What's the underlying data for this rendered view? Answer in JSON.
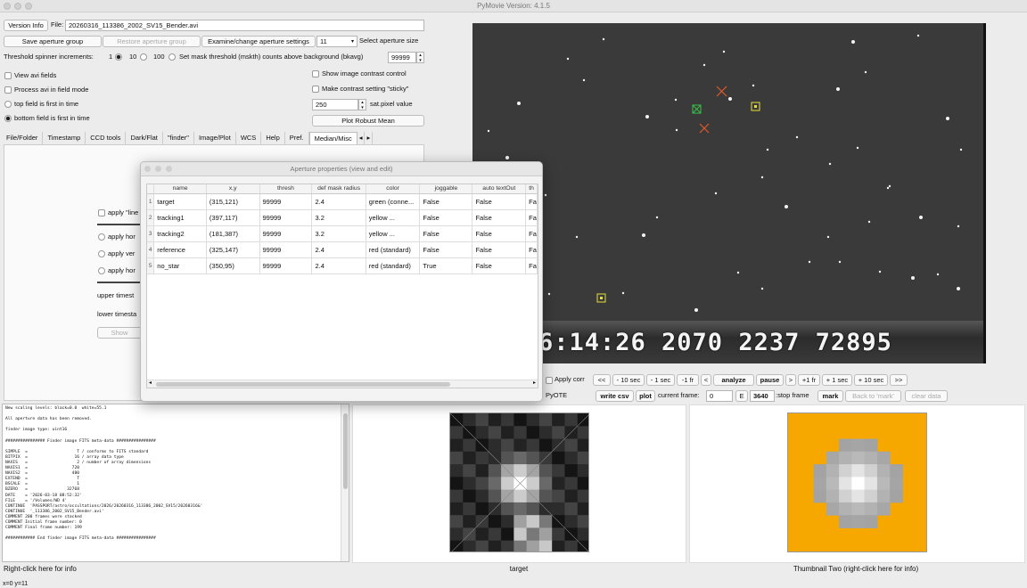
{
  "window": {
    "title": "PyMovie  Version: 4.1.5"
  },
  "top": {
    "version_info_btn": "Version Info",
    "file_label": "File:",
    "file_value": "20260316_113386_2002_SV15_Bender.avi",
    "save_aperture_group": "Save aperture group",
    "restore_aperture_group": "Restore aperture group",
    "examine_aperture_settings": "Examine/change aperture settings",
    "aperture_size_value": "11",
    "select_aperture_size": "Select aperture size",
    "threshold_label": "Threshold spinner increments:",
    "inc_1": "1",
    "inc_10": "10",
    "inc_100": "100",
    "mask_label": "Set mask threshold (mskth) counts above background (bkavg)",
    "mask_value": "99999",
    "view_avi_fields": "View avi fields",
    "process_avi_field_mode": "Process avi in field mode",
    "top_field_first": "top field is first in time",
    "bottom_field_first": "bottom field is first in time",
    "show_contrast_control": "Show image contrast control",
    "sticky_contrast": "Make contrast setting \"sticky\"",
    "sat_pixel_value": "250",
    "sat_pixel_label": "sat.pixel value",
    "plot_robust_mean": "Plot Robust Mean"
  },
  "tabs": [
    "File/Folder",
    "Timestamp",
    "CCD tools",
    "Dark/Flat",
    "\"finder\"",
    "Image/Plot",
    "WCS",
    "Help",
    "Pref.",
    "Median/Misc"
  ],
  "selected_tab": "Median/Misc",
  "median_panel": {
    "apply_line": "apply \"line",
    "apply_hor_1": "apply hor",
    "apply_ver": "apply ver",
    "apply_hor_2": "apply hor",
    "upper_timestamp": "upper timest",
    "lower_timestamp": "lower timesta",
    "show_btn": "Show"
  },
  "dialog": {
    "title": "Aperture properties (view and edit)",
    "columns": [
      "name",
      "x,y",
      "thresh",
      "def mask radius",
      "color",
      "joggable",
      "auto textOut",
      "th"
    ],
    "rows": [
      [
        "1",
        "target",
        "(315,121)",
        "99999",
        "2.4",
        "green (conne...",
        "False",
        "False",
        "Fa"
      ],
      [
        "2",
        "tracking1",
        "(397,117)",
        "99999",
        "3.2",
        "yellow ...",
        "False",
        "False",
        "Fa"
      ],
      [
        "3",
        "tracking2",
        "(181,387)",
        "99999",
        "3.2",
        "yellow ...",
        "False",
        "False",
        "Fa"
      ],
      [
        "4",
        "reference",
        "(325,147)",
        "99999",
        "2.4",
        "red (standard)",
        "False",
        "False",
        "Fa"
      ],
      [
        "5",
        "no_star",
        "(350,95)",
        "99999",
        "2.4",
        "red (standard)",
        "True",
        "False",
        "Fa"
      ]
    ]
  },
  "log": {
    "text": "New scaling levels: black=0.0  white=55.1\n\nAll aperture data has been removed.\n\nfinder image type: uint16\n\n################ Finder image FITS meta-data ################\n\nSIMPLE  =                    T / conforms to FITS standard\nBITPIX  =                   16 / array data type\nNAXIS   =                    2 / number of array dimensions\nNAXIS1  =                  720\nNAXIS2  =                  480\nEXTEND  =                    T\nBSCALE  =                    1\nBZERO   =                32768\nDATE    = '2026-03-18 08:52:32'\nFILE    = '/Volumes/WD 4'\nCONTINUE  'PASSPORT/astro/occultations/2026/20260316_113386_2002_SV15/20260316&'\nCONTINUE  '_113386_2002_SV15_Bender.avi'\nCOMMENT 200 frames were stacked\nCOMMENT Initial frame number: 0\nCOMMENT Final frame number: 199\n\n############ End finder image FITS meta-data ################"
  },
  "video": {
    "timestamp": "6:14:26 2070 2237 72895"
  },
  "controls": {
    "apply_corr": "Apply corr",
    "back_10s": "- 10 sec",
    "back_1s": "- 1 sec",
    "back_1fr": "-1 fr",
    "prev": "<",
    "prev_far": "<<",
    "analyze": "analyze",
    "pause": "pause",
    "next": ">",
    "fwd_1fr": "+1 fr",
    "fwd_1s": "+ 1 sec",
    "fwd_10s": "+ 10 sec",
    "next_far": ">>",
    "pyote": "PyOTE",
    "write_csv": "write csv",
    "plot": "plot",
    "current_frame_label": "current frame:",
    "current_frame_value": "0",
    "e_btn": "E",
    "stop_frame_value": "3640",
    "stop_frame_label": ":stop frame",
    "mark": "mark",
    "back_to_mark": "Back to 'mark'",
    "clear_data": "clear data"
  },
  "thumbs": {
    "left_info": "Right-click here for info",
    "target_caption": "target",
    "two_caption": "Thumbnail Two (right-click here for info)"
  },
  "status": {
    "coords": "x=0 y=11"
  },
  "colors": {
    "thumb_two_bg": "#f7a800",
    "video_bg": "#3a3a3a"
  }
}
